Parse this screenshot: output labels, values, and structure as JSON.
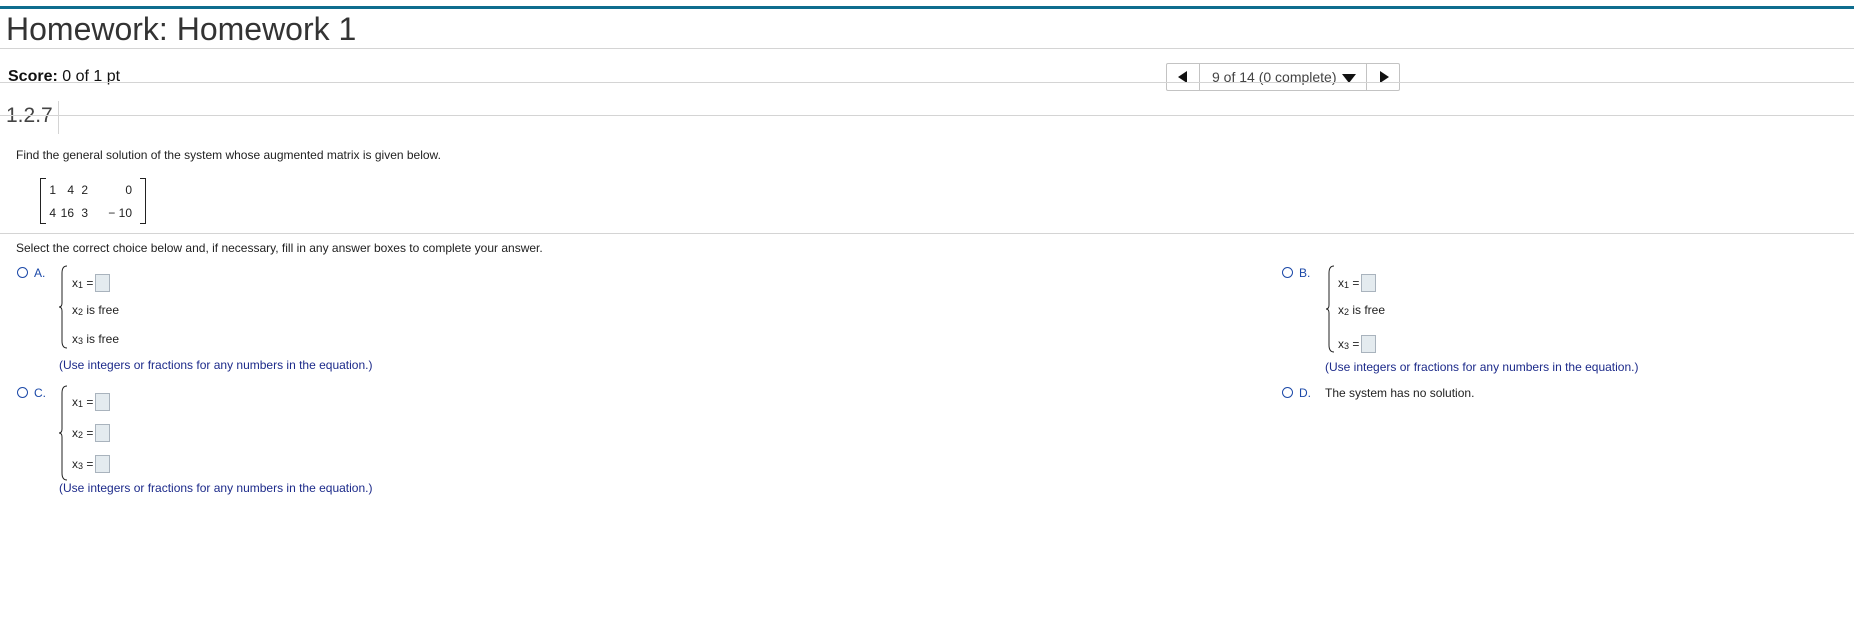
{
  "header": {
    "title": "Homework: Homework 1"
  },
  "score": {
    "label": "Score:",
    "value": "0 of 1 pt"
  },
  "nav": {
    "position_label": "9 of 14 (0 complete)"
  },
  "question": {
    "number": "1.2.7",
    "prompt": "Find the general solution of the system whose augmented matrix is given below.",
    "matrix": {
      "row1": [
        "1",
        "4",
        "2",
        "0"
      ],
      "row2": [
        "4",
        "16",
        "3",
        "− 10"
      ]
    },
    "instruction": "Select the correct choice below and, if necessary, fill in any answer boxes to complete your answer.",
    "vars": {
      "x": "x",
      "s1": "1",
      "s2": "2",
      "s3": "3",
      "eq": " =",
      "free": " is free"
    },
    "hint": "(Use integers or fractions for any numbers in the equation.)",
    "choices": {
      "A": {
        "label": "A."
      },
      "B": {
        "label": "B."
      },
      "C": {
        "label": "C."
      },
      "D": {
        "label": "D.",
        "text": "The system has no solution."
      }
    }
  },
  "colors": {
    "accent_bar": "#0e6d8e",
    "choice_blue": "#1c49a8",
    "answer_box": "#e4ebef"
  }
}
